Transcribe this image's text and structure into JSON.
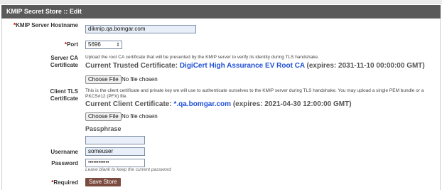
{
  "title": "KMIP Secret Store :: Edit",
  "fields": {
    "server_hostname": {
      "label": "KMIP Server Hostname",
      "value": "dikmip.qa.bomgar.com",
      "required": true
    },
    "port": {
      "label": "Port",
      "value": "5696",
      "required": true
    },
    "server_ca": {
      "label": "Server CA Certificate",
      "help": "Upload the root CA certificate that will be presented by the KMIP server to verify its identity during TLS handshake.",
      "current_prefix": "Current Trusted Certificate: ",
      "current_cn": "DigiCert High Assurance EV Root CA",
      "current_expires": " (expires: 2031-11-10 00:00:00 GMT)",
      "choose_file": "Choose File",
      "no_file": "No file chosen"
    },
    "client_tls": {
      "label": "Client TLS Certificate",
      "help": "This is the client certificate and private key we will use to authenticate ourselves to the KMIP server during TLS handshake. You may upload a single PEM bundle or a PKCS#12 (PFX) file.",
      "current_prefix": "Current Client Certificate: ",
      "current_cn": "*.qa.bomgar.com",
      "current_expires": " (expires: 2021-04-30 12:00:00 GMT)",
      "choose_file": "Choose File",
      "no_file": "No file chosen",
      "passphrase_label": "Passphrase",
      "passphrase_value": ""
    },
    "username": {
      "label": "Username",
      "value": "someuser"
    },
    "password": {
      "label": "Password",
      "value": "••••••••••••",
      "hint": "Leave blank to keep the current password"
    }
  },
  "required_marker": "*",
  "required_label": "Required",
  "save_label": "Save Store",
  "spinner_glyph": "⇕",
  "colors": {
    "title_bg": "#5a5a5a",
    "required": "#c00000",
    "cert_cn": "#1f4fd6",
    "save_bg": "#7b4b3f"
  }
}
